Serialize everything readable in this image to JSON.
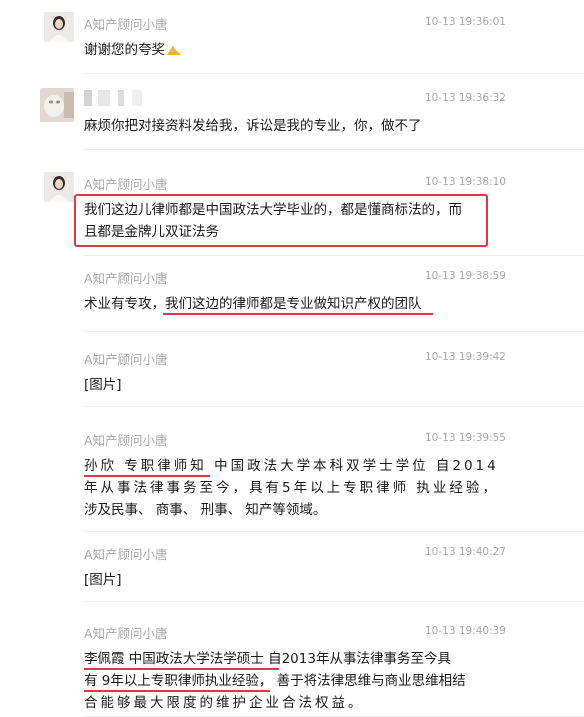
{
  "messages": [
    {
      "sender": "A知产顾问小唐",
      "time": "10-13 19:36:01",
      "text": "谢谢您的夸奖",
      "emoji": "praying-hands-icon"
    },
    {
      "sender": "",
      "time": "10-13 19:36:32",
      "text": "麻烦你把对接资料发给我，诉讼是我的专业，你，做不了"
    },
    {
      "sender": "A知产顾问小唐",
      "time": "10-13 19:38:10",
      "lines": [
        "我们这边儿律师都是中国政法大学毕业的，都是懂商标法的，而",
        "且都是金牌儿双证法务"
      ]
    },
    {
      "sender": "A知产顾问小唐",
      "time": "10-13 19:38:59",
      "text_a": "术业有专攻，",
      "text_b": "我们这边的律师都是专业做知识产权的团队"
    },
    {
      "sender": "A知产顾问小唐",
      "time": "10-13 19:39:42",
      "text": "[图片]"
    },
    {
      "sender": "A知产顾问小唐",
      "time": "10-13 19:39:55",
      "lines": [
        "孙欣 专职律师知 中国政法大学本科双学士学位 自2014",
        "年从事法律事务至今，具有5年以上专职律师 执业经验，",
        "涉及民事、 商事、 刑事、 知产等领域。"
      ]
    },
    {
      "sender": "A知产顾问小唐",
      "time": "10-13 19:40:27",
      "text": "[图片]"
    },
    {
      "sender": "A知产顾问小唐",
      "time": "10-13 19:40:39",
      "lines": [
        "李佩霞  中国政法大学法学硕士   自2013年从事法律事务至今具",
        "有 9年以上专职律师执业经验， 善于将法律思维与商业思维相结",
        "合能够最大限度的维护企业合法权益。"
      ]
    }
  ],
  "colors": {
    "highlight": "#e0364a",
    "meta_text": "#a8a8a8"
  }
}
